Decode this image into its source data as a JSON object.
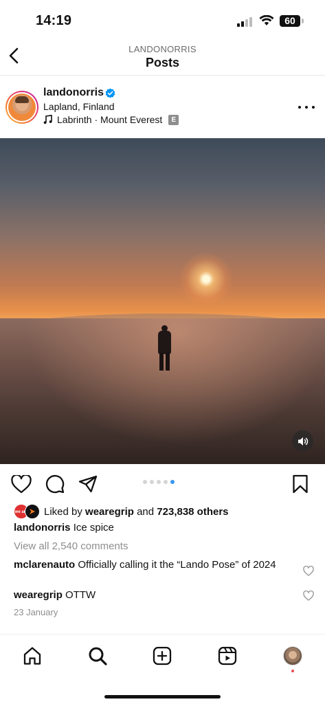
{
  "status_bar": {
    "time": "14:19",
    "battery": "60"
  },
  "header": {
    "account": "LANDONORRIS",
    "title": "Posts"
  },
  "post": {
    "username": "landonorris",
    "verified": true,
    "location": "Lapland, Finland",
    "music": "Labrinth · Mount Everest",
    "explicit_badge": "E",
    "carousel": {
      "count": 5,
      "active_index": 4
    },
    "likes": {
      "prefix": "Liked by",
      "liked_by": "wearegrip",
      "connector": "and",
      "others": "723,838 others",
      "avatar_text": "we are grip"
    },
    "caption": {
      "username": "landonorris",
      "text": "Ice spice"
    },
    "view_comments": "View all 2,540 comments",
    "comments": [
      {
        "username": "mclarenauto",
        "text": "Officially calling it the “Lando Pose” of 2024"
      },
      {
        "username": "wearegrip",
        "text": "OTTW"
      }
    ],
    "date": "23 January"
  },
  "icons": {
    "back": "chevron-left-icon",
    "verified": "verified-badge-icon",
    "music": "music-note-icon",
    "more": "more-options-icon",
    "sound": "speaker-icon",
    "like": "heart-icon",
    "comment": "comment-icon",
    "share": "send-icon",
    "save": "bookmark-icon",
    "nav": [
      "home-icon",
      "search-icon",
      "create-icon",
      "reels-icon",
      "profile-avatar"
    ]
  },
  "colors": {
    "accent_blue": "#3897f0",
    "verified_blue": "#0095f6",
    "notification_red": "#ed4956",
    "muted_text": "#8e8e8e"
  }
}
